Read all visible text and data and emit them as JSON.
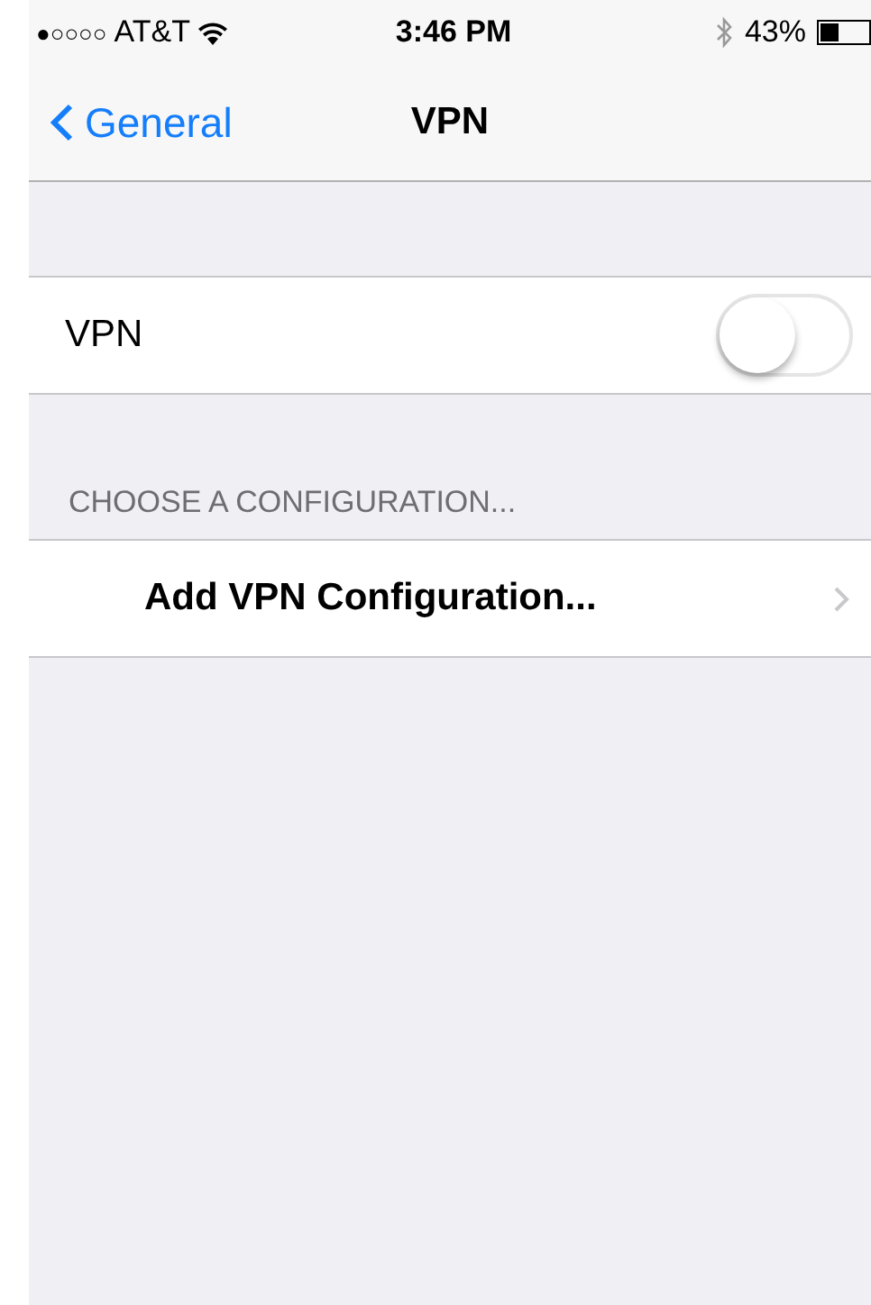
{
  "status_bar": {
    "signal": "●○○○○",
    "carrier": "AT&T",
    "time": "3:46 PM",
    "battery": "43%"
  },
  "nav_bar": {
    "back": "General",
    "title": "VPN"
  },
  "vpn_row": {
    "label": "VPN",
    "on": false
  },
  "section_header": "CHOOSE A CONFIGURATION...",
  "config_rows": [
    {
      "label": "Add VPN Configuration..."
    }
  ]
}
